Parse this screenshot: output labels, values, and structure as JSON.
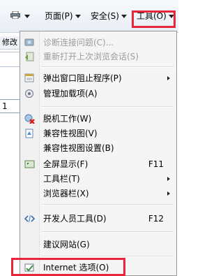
{
  "toolbar": {
    "print_caret": "",
    "page_label": "页面(P)",
    "safety_label": "安全(S)",
    "tools_label": "工具(O)"
  },
  "background": {
    "tab_text": "修改",
    "cell_text": "1"
  },
  "menu": {
    "items": [
      {
        "label": "诊断连接问题(C)...",
        "disabled": true,
        "icon": "network-diagnose-icon"
      },
      {
        "label": "重新打开上次浏览会话(S)",
        "disabled": true,
        "icon": "reopen-session-icon"
      },
      {
        "label": "弹出窗口阻止程序(P)",
        "submenu": true,
        "icon": "popup-blocker-icon"
      },
      {
        "label": "管理加载项(A)",
        "icon": "manage-addons-icon"
      },
      {
        "label": "脱机工作(W)",
        "icon": "work-offline-icon"
      },
      {
        "label": "兼容性视图(V)",
        "icon": "compatibility-view-icon"
      },
      {
        "label": "兼容性视图设置(B)",
        "icon": ""
      },
      {
        "label": "全屏显示(F)",
        "accel": "F11",
        "icon": "fullscreen-icon"
      },
      {
        "label": "工具栏(T)",
        "submenu": true,
        "icon": ""
      },
      {
        "label": "浏览器栏(X)",
        "submenu": true,
        "icon": ""
      },
      {
        "label": "开发人员工具(D)",
        "accel": "F12",
        "icon": "developer-tools-icon"
      },
      {
        "label": "建议网站(G)",
        "icon": ""
      },
      {
        "label": "Internet 选项(O)",
        "icon": "internet-options-icon"
      }
    ]
  },
  "colors": {
    "highlight": "#e8253a",
    "menu_bg": "#f5f5f5",
    "disabled_text": "#9c9c9c"
  }
}
